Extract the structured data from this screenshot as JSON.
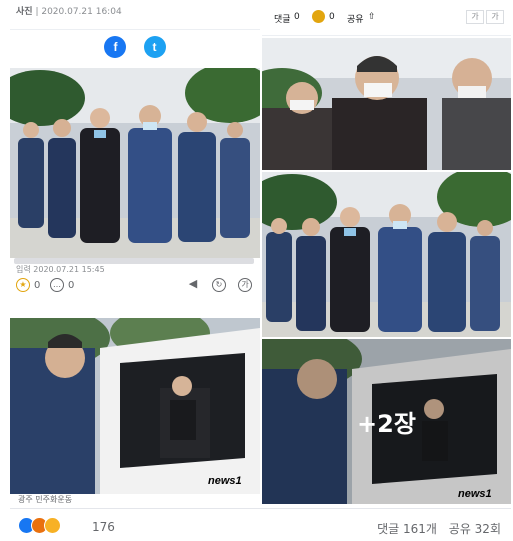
{
  "article": {
    "caption_label": "사진",
    "caption_date": "2020.07.21 16:04",
    "input_time": "입력 2020.07.21 15:45",
    "reaction_count_small": "0",
    "comment_count_small": "0",
    "bottom_caption": "광주 민주화운동"
  },
  "share": {
    "facebook_glyph": "f",
    "twitter_glyph": "t"
  },
  "stats_bar": {
    "comments_label": "댓글",
    "comments_value": "0",
    "likes_value": "0",
    "share_label": "공유",
    "font_small": "가",
    "font_large": "가"
  },
  "gallery": {
    "more_overlay": "+2장",
    "watermark": "news1"
  },
  "footer": {
    "reaction_count": "176",
    "comments": "댓글 161개",
    "shares": "공유 32회"
  },
  "colors": {
    "facebook": "#1877f2",
    "twitter": "#1da1f2",
    "like": "#1877f2",
    "angry": "#e9710f",
    "haha": "#f7b125"
  },
  "icons": [
    "facebook-icon",
    "twitter-icon",
    "like-reaction-icon",
    "comment-icon",
    "share-icon",
    "speaker-icon",
    "font-size-icon"
  ]
}
